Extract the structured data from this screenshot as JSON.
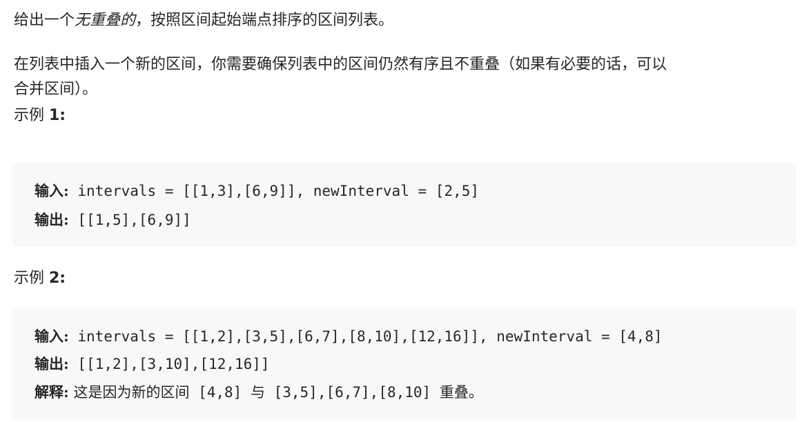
{
  "intro": {
    "before": "给出一个",
    "emphasis": "无重叠的",
    "after": "，按照区间起始端点排序的区间列表。"
  },
  "task": {
    "line1": "在列表中插入一个新的区间，你需要确保列表中的区间仍然有序且不重叠（如果有必要的话，可以",
    "line2": "合并区间）。"
  },
  "examples": [
    {
      "heading_prefix": "示例 ",
      "heading_num": "1:",
      "input_label": "输入:",
      "input_value": " intervals = [[1,3],[6,9]], newInterval = [2,5]",
      "output_label": "输出:",
      "output_value": " [[1,5],[6,9]]"
    },
    {
      "heading_prefix": "示例 ",
      "heading_num": "2:",
      "input_label": "输入:",
      "input_value": " intervals = [[1,2],[3,5],[6,7],[8,10],[12,16]], newInterval = [4,8]",
      "output_label": "输出:",
      "output_value": " [[1,2],[3,10],[12,16]]",
      "explain_label": "解释:",
      "explain_text_1": " 这是因为新的区间",
      "explain_code_1": " [4,8] ",
      "explain_text_2": "与",
      "explain_code_2": " [3,5],[6,7],[8,10] ",
      "explain_text_3": "重叠。"
    }
  ]
}
